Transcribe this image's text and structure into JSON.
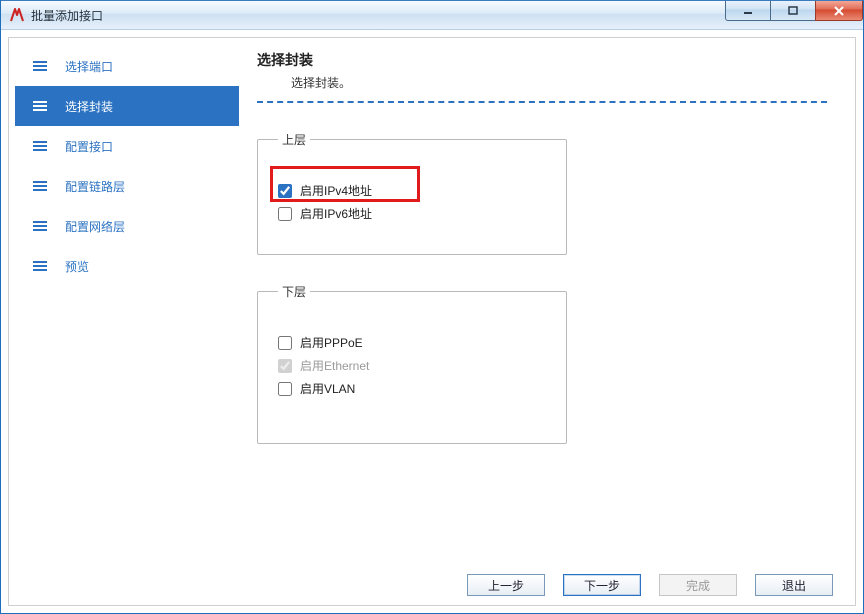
{
  "window": {
    "title": "批量添加接口"
  },
  "sidebar": {
    "items": [
      {
        "label": "选择端口",
        "active": false
      },
      {
        "label": "选择封装",
        "active": true
      },
      {
        "label": "配置接口",
        "active": false
      },
      {
        "label": "配置链路层",
        "active": false
      },
      {
        "label": "配置网络层",
        "active": false
      },
      {
        "label": "预览",
        "active": false
      }
    ]
  },
  "main": {
    "heading": "选择封装",
    "subheading": "选择封装。",
    "group_upper": {
      "legend": "上层",
      "options": [
        {
          "label": "启用IPv4地址",
          "checked": true,
          "disabled": false
        },
        {
          "label": "启用IPv6地址",
          "checked": false,
          "disabled": false
        }
      ]
    },
    "group_lower": {
      "legend": "下层",
      "options": [
        {
          "label": "启用PPPoE",
          "checked": false,
          "disabled": false
        },
        {
          "label": "启用Ethernet",
          "checked": true,
          "disabled": true
        },
        {
          "label": "启用VLAN",
          "checked": false,
          "disabled": false
        }
      ]
    }
  },
  "footer": {
    "back": "上一步",
    "next": "下一步",
    "finish": "完成",
    "exit": "退出"
  }
}
